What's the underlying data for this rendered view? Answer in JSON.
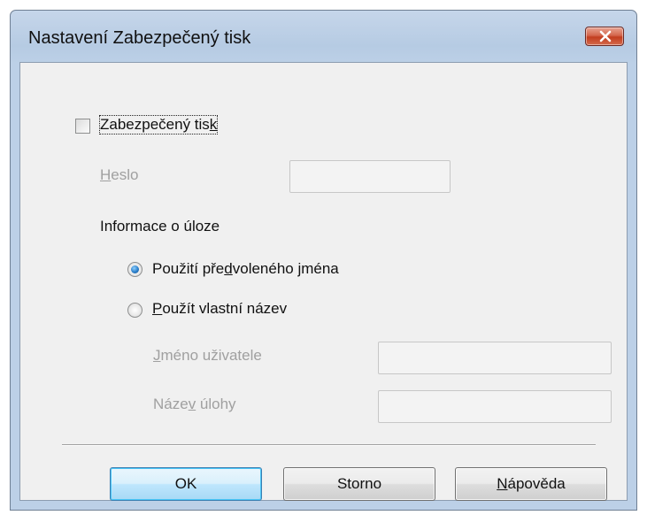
{
  "window": {
    "title": "Nastavení Zabezpečený tisk"
  },
  "secure_print": {
    "checkbox_label_prefix": "Zabezpečený tis",
    "checkbox_label_accel": "k",
    "checked": false
  },
  "password": {
    "label_accel": "H",
    "label_rest": "eslo",
    "value": ""
  },
  "job_info": {
    "heading": "Informace o úloze",
    "option_default": {
      "before": "Použití pře",
      "accel": "d",
      "after": "voleného jména",
      "selected": true
    },
    "option_custom": {
      "before": "",
      "accel": "P",
      "after": "oužít vlastní název",
      "selected": false
    },
    "user_name": {
      "label_accel": "J",
      "label_rest": "méno uživatele",
      "value": ""
    },
    "job_name": {
      "label_before": "Náze",
      "label_accel": "v",
      "label_rest": " úlohy",
      "value": ""
    }
  },
  "buttons": {
    "ok": "OK",
    "cancel": "Storno",
    "help_accel": "N",
    "help_rest": "ápověda"
  }
}
